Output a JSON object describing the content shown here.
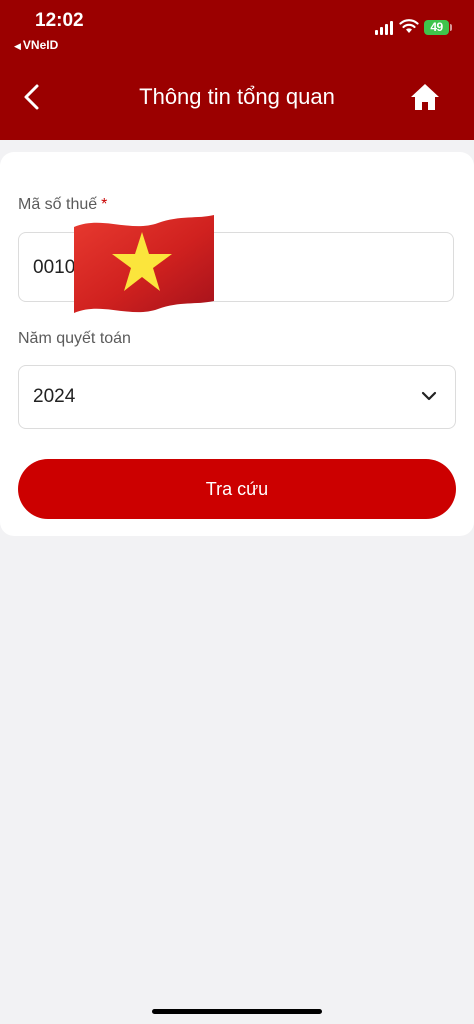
{
  "status_bar": {
    "time": "12:02",
    "back_app": "VNeID",
    "battery": "49"
  },
  "header": {
    "title": "Thông tin tổng quan",
    "back_icon": "chevron-left-icon",
    "home_icon": "home-icon",
    "color": "#9b0000"
  },
  "form": {
    "tax_code": {
      "label": "Mã số thuế",
      "required_mark": "*",
      "value": "0010"
    },
    "year": {
      "label": "Năm quyết toán",
      "value": "2024"
    },
    "submit_label": "Tra cứu",
    "submit_color": "#cc0000"
  }
}
